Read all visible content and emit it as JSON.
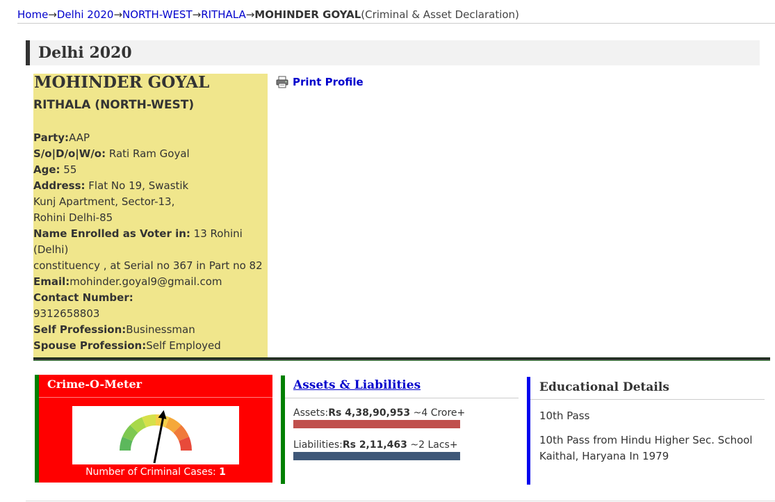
{
  "breadcrumb": {
    "items": [
      "Home",
      "Delhi 2020",
      "NORTH-WEST",
      "RITHALA"
    ],
    "arrow": "→",
    "current": "MOHINDER GOYAL",
    "suffix": "(Criminal & Asset Declaration)"
  },
  "section": {
    "title": "Delhi 2020"
  },
  "profile": {
    "name": "MOHINDER GOYAL",
    "constituency": "RITHALA (NORTH-WEST)",
    "party_label": "Party:",
    "party": "AAP",
    "relation_label": "S/o|D/o|W/o:",
    "relation": " Rati Ram Goyal",
    "age_label": "Age:",
    "age": " 55",
    "address_label": "Address:",
    "address_1": " Flat No 19, Swastik",
    "address_2": "Kunj Apartment, Sector-13,",
    "address_3": "Rohini Delhi-85",
    "voter_label": "Name Enrolled as Voter in:",
    "voter_1": " 13 Rohini (Delhi)",
    "voter_2": "constituency , at Serial no 367 in Part no 82",
    "email_label": "Email:",
    "email": "mohinder.goyal9@gmail.com",
    "contact_label": "Contact Number:",
    "contact": "9312658803",
    "self_prof_label": "Self Profession:",
    "self_prof": "Businessman",
    "spouse_prof_label": "Spouse Profession:",
    "spouse_prof": "Self Employed"
  },
  "print": {
    "label": "Print Profile",
    "icon": "printer-icon"
  },
  "crime": {
    "title": "Crime-O-Meter",
    "count_label": "Number of Criminal Cases: ",
    "count": "1",
    "meter_level": 0.6
  },
  "assets": {
    "title": "Assets & Liabilities",
    "assets_label": "Assets:",
    "assets_value": "Rs 4,38,90,953",
    "assets_approx": " ~4 Crore+",
    "liabilities_label": "Liabilities:",
    "liabilities_value": "Rs 2,11,463",
    "liabilities_approx": " ~2 Lacs+",
    "assets_color": "#c0504d",
    "liabilities_color": "#3f5878"
  },
  "education": {
    "title": "Educational Details",
    "level": "10th Pass",
    "detail_1": "10th Pass from Hindu Higher Sec. School",
    "detail_2": "Kaithal, Haryana In 1979"
  }
}
